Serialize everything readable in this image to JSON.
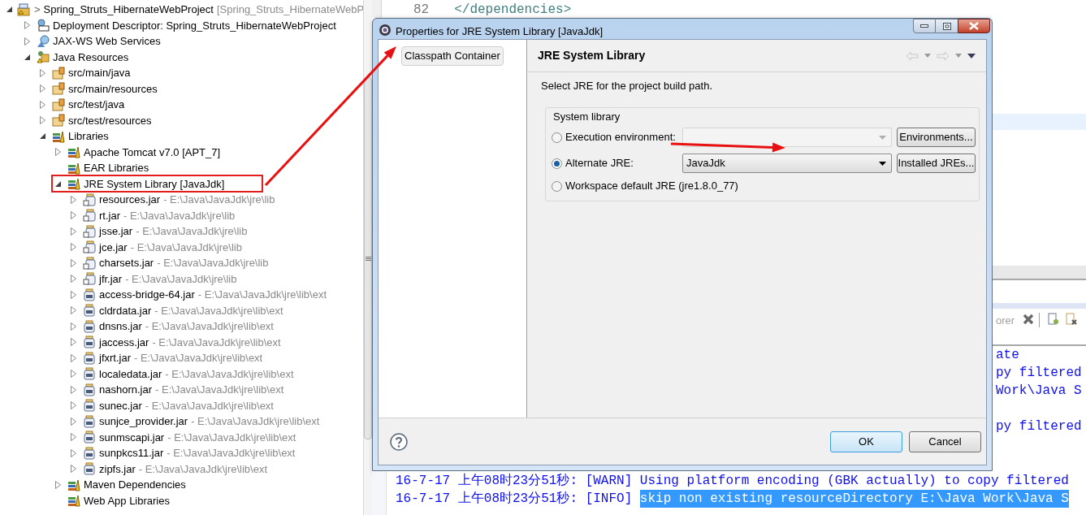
{
  "explorer": {
    "tree": [
      {
        "kind": "project",
        "has_arrow": true,
        "expanded": true,
        "highlighted": false,
        "marker": ">",
        "label": "Spring_Struts_HibernateWebProject",
        "decoration": "[Spring_Struts_HibernateWebP",
        "children": [
          {
            "kind": "descriptor",
            "has_arrow": true,
            "expanded": false,
            "highlighted": false,
            "label": "Deployment Descriptor: Spring_Struts_HibernateWebProject"
          },
          {
            "kind": "webservices",
            "has_arrow": true,
            "expanded": false,
            "highlighted": false,
            "label": "JAX-WS Web Services"
          },
          {
            "kind": "resources",
            "has_arrow": true,
            "expanded": true,
            "highlighted": false,
            "label": "Java Resources",
            "children": [
              {
                "kind": "source-folder",
                "has_arrow": true,
                "expanded": false,
                "highlighted": false,
                "label": "src/main/java"
              },
              {
                "kind": "source-folder",
                "has_arrow": true,
                "expanded": false,
                "highlighted": false,
                "label": "src/main/resources"
              },
              {
                "kind": "source-folder",
                "has_arrow": true,
                "expanded": false,
                "highlighted": false,
                "label": "src/test/java"
              },
              {
                "kind": "source-folder",
                "has_arrow": true,
                "expanded": false,
                "highlighted": false,
                "label": "src/test/resources"
              },
              {
                "kind": "library",
                "has_arrow": true,
                "expanded": true,
                "highlighted": false,
                "label": "Libraries",
                "children": [
                  {
                    "kind": "library",
                    "has_arrow": true,
                    "expanded": false,
                    "highlighted": false,
                    "label": "Apache Tomcat v7.0 [APT_7]"
                  },
                  {
                    "kind": "library",
                    "has_arrow": false,
                    "highlighted": false,
                    "label": "EAR Libraries"
                  },
                  {
                    "kind": "library",
                    "has_arrow": true,
                    "expanded": true,
                    "highlighted": true,
                    "label": "JRE System Library [JavaJdk]",
                    "children": [
                      {
                        "kind": "jar-doc",
                        "has_arrow": true,
                        "expanded": false,
                        "highlighted": false,
                        "label": "resources.jar",
                        "decoration": "- E:\\Java\\JavaJdk\\jre\\lib"
                      },
                      {
                        "kind": "jar-doc",
                        "has_arrow": true,
                        "expanded": false,
                        "highlighted": false,
                        "label": "rt.jar",
                        "decoration": "- E:\\Java\\JavaJdk\\jre\\lib"
                      },
                      {
                        "kind": "jar-doc",
                        "has_arrow": true,
                        "expanded": false,
                        "highlighted": false,
                        "label": "jsse.jar",
                        "decoration": "- E:\\Java\\JavaJdk\\jre\\lib"
                      },
                      {
                        "kind": "jar-doc",
                        "has_arrow": true,
                        "expanded": false,
                        "highlighted": false,
                        "label": "jce.jar",
                        "decoration": "- E:\\Java\\JavaJdk\\jre\\lib"
                      },
                      {
                        "kind": "jar-doc",
                        "has_arrow": true,
                        "expanded": false,
                        "highlighted": false,
                        "label": "charsets.jar",
                        "decoration": "- E:\\Java\\JavaJdk\\jre\\lib"
                      },
                      {
                        "kind": "jar-doc",
                        "has_arrow": true,
                        "expanded": false,
                        "highlighted": false,
                        "label": "jfr.jar",
                        "decoration": "- E:\\Java\\JavaJdk\\jre\\lib"
                      },
                      {
                        "kind": "jar",
                        "has_arrow": true,
                        "expanded": false,
                        "highlighted": false,
                        "label": "access-bridge-64.jar",
                        "decoration": "- E:\\Java\\JavaJdk\\jre\\lib\\ext"
                      },
                      {
                        "kind": "jar",
                        "has_arrow": true,
                        "expanded": false,
                        "highlighted": false,
                        "label": "cldrdata.jar",
                        "decoration": "- E:\\Java\\JavaJdk\\jre\\lib\\ext"
                      },
                      {
                        "kind": "jar",
                        "has_arrow": true,
                        "expanded": false,
                        "highlighted": false,
                        "label": "dnsns.jar",
                        "decoration": "- E:\\Java\\JavaJdk\\jre\\lib\\ext"
                      },
                      {
                        "kind": "jar",
                        "has_arrow": true,
                        "expanded": false,
                        "highlighted": false,
                        "label": "jaccess.jar",
                        "decoration": "- E:\\Java\\JavaJdk\\jre\\lib\\ext"
                      },
                      {
                        "kind": "jar",
                        "has_arrow": true,
                        "expanded": false,
                        "highlighted": false,
                        "label": "jfxrt.jar",
                        "decoration": "- E:\\Java\\JavaJdk\\jre\\lib\\ext"
                      },
                      {
                        "kind": "jar",
                        "has_arrow": true,
                        "expanded": false,
                        "highlighted": false,
                        "label": "localedata.jar",
                        "decoration": "- E:\\Java\\JavaJdk\\jre\\lib\\ext"
                      },
                      {
                        "kind": "jar",
                        "has_arrow": true,
                        "expanded": false,
                        "highlighted": false,
                        "label": "nashorn.jar",
                        "decoration": "- E:\\Java\\JavaJdk\\jre\\lib\\ext"
                      },
                      {
                        "kind": "jar",
                        "has_arrow": true,
                        "expanded": false,
                        "highlighted": false,
                        "label": "sunec.jar",
                        "decoration": "- E:\\Java\\JavaJdk\\jre\\lib\\ext"
                      },
                      {
                        "kind": "jar",
                        "has_arrow": true,
                        "expanded": false,
                        "highlighted": false,
                        "label": "sunjce_provider.jar",
                        "decoration": "- E:\\Java\\JavaJdk\\jre\\lib\\ext"
                      },
                      {
                        "kind": "jar",
                        "has_arrow": true,
                        "expanded": false,
                        "highlighted": false,
                        "label": "sunmscapi.jar",
                        "decoration": "- E:\\Java\\JavaJdk\\jre\\lib\\ext"
                      },
                      {
                        "kind": "jar",
                        "has_arrow": true,
                        "expanded": false,
                        "highlighted": false,
                        "label": "sunpkcs11.jar",
                        "decoration": "- E:\\Java\\JavaJdk\\jre\\lib\\ext"
                      },
                      {
                        "kind": "jar",
                        "has_arrow": true,
                        "expanded": false,
                        "highlighted": false,
                        "label": "zipfs.jar",
                        "decoration": "- E:\\Java\\JavaJdk\\jre\\lib\\ext"
                      }
                    ]
                  },
                  {
                    "kind": "library",
                    "has_arrow": true,
                    "expanded": false,
                    "highlighted": false,
                    "label": "Maven Dependencies"
                  },
                  {
                    "kind": "library",
                    "has_arrow": false,
                    "highlighted": false,
                    "label": "Web App Libraries"
                  }
                ]
              }
            ]
          }
        ]
      }
    ]
  },
  "editor": {
    "line_number": "82",
    "code": "</dependencies>"
  },
  "side_view": {
    "tab_fragment": "orer",
    "console_blocks": [
      [
        "ate",
        "py filtered",
        "Work\\Java S"
      ],
      [
        "py filtered"
      ]
    ]
  },
  "console": [
    {
      "timestamp": "16-7-17 上午08时23分51秒:",
      "level": "[WARN]",
      "message": "Using platform encoding (GBK actually) to copy filtered",
      "selected": false
    },
    {
      "timestamp": "16-7-17 上午08时23分51秒:",
      "level": "[INFO]",
      "message": "skip non existing resourceDirectory E:\\Java Work\\Java S",
      "selected": true
    }
  ],
  "dialog": {
    "title": "Properties for JRE System Library [JavaJdk]",
    "pages": [
      {
        "label": "Classpath Container",
        "selected": true
      }
    ],
    "heading": "JRE System Library",
    "description": "Select JRE for the project build path.",
    "group": {
      "title": "System library",
      "options": [
        {
          "label": "Execution environment:",
          "selected": false,
          "combo": {
            "disabled": true
          },
          "button": "Environments..."
        },
        {
          "label": "Alternate JRE:",
          "selected": true,
          "combo": {
            "value": "JavaJdk",
            "disabled": false
          },
          "button": "Installed JREs..."
        },
        {
          "label": "Workspace default JRE (jre1.8.0_77)",
          "selected": false
        }
      ]
    },
    "buttons": [
      {
        "label": "OK",
        "default": true
      },
      {
        "label": "Cancel",
        "default": false
      }
    ]
  }
}
